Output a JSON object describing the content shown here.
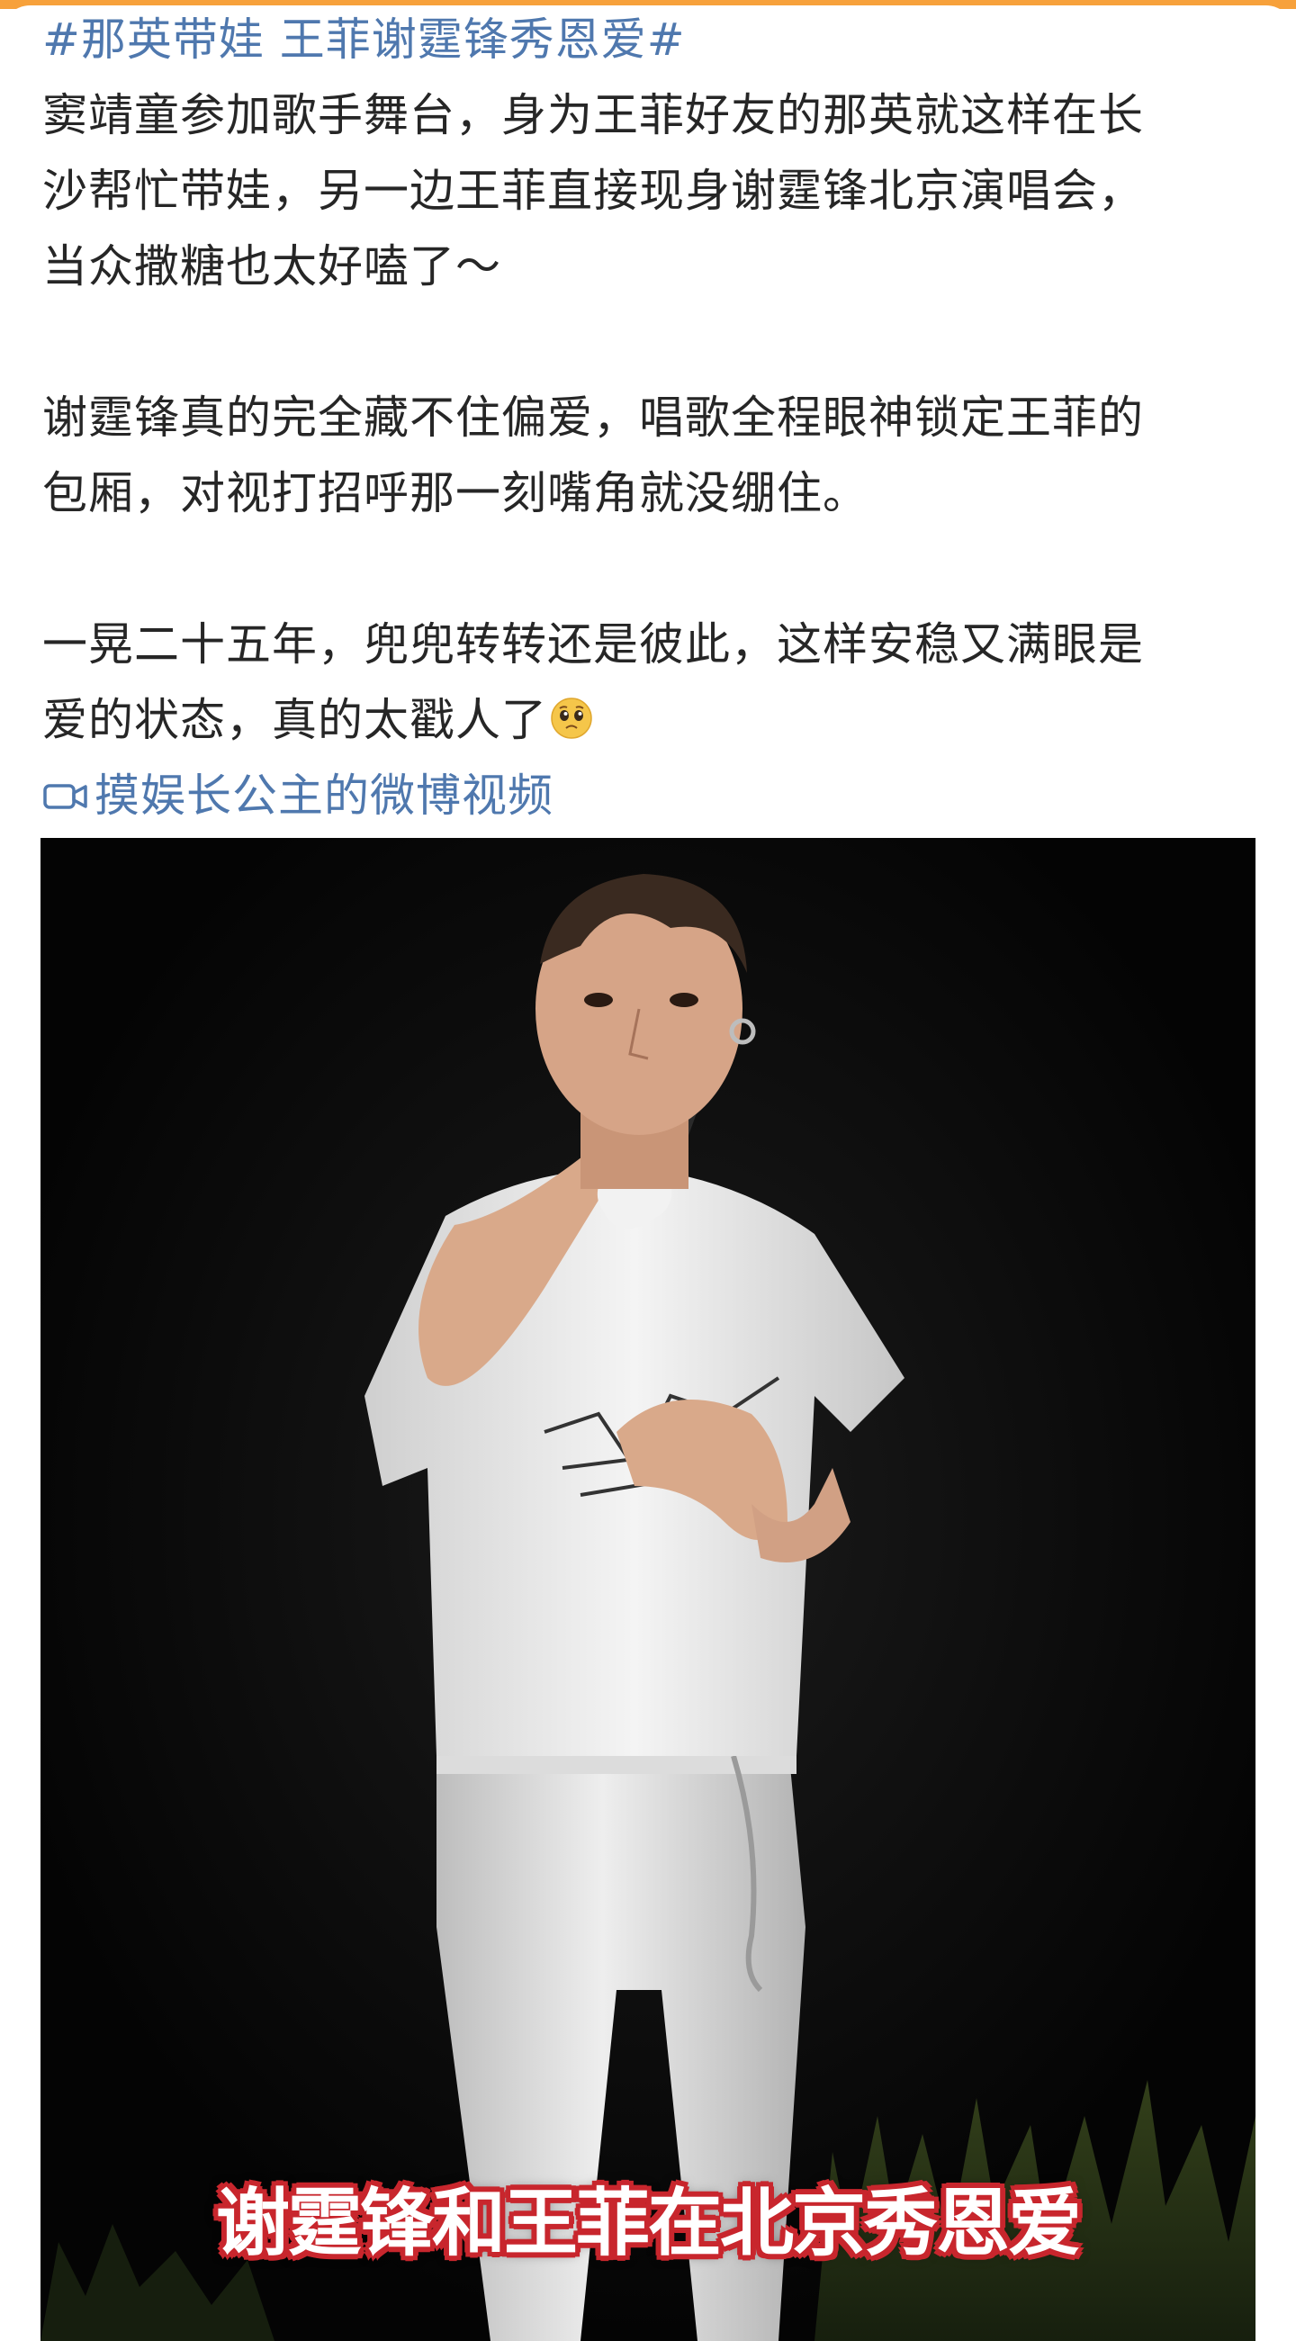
{
  "post": {
    "topic": "#那英带娃 王菲谢霆锋秀恩爱#",
    "paragraphs": [
      {
        "lines": [
          "窦靖童参加歌手舞台，身为王菲好友的那英就这样在长",
          "沙帮忙带娃，另一边王菲直接现身谢霆锋北京演唱会，",
          "当众撒糖也太好嗑了～"
        ]
      },
      {
        "lines": [
          "谢霆锋真的完全藏不住偏爱，唱歌全程眼神锁定王菲的",
          "包厢，对视打招呼那一刻嘴角就没绷住。"
        ]
      },
      {
        "lines": [
          "一晃二十五年，兜兜转转还是彼此，这样安稳又满眼是",
          "爱的状态，真的太戳人了"
        ],
        "trailing_emoji": "pleading-face-emoji"
      }
    ],
    "video_link": {
      "icon": "video-camera-icon",
      "label": "摸娱长公主的微博视频"
    }
  },
  "video": {
    "caption": "谢霆锋和王菲在北京秀恩爱",
    "caption_color": "#ffffff",
    "caption_outline": "#c8262d"
  },
  "colors": {
    "link": "#4f78ae",
    "text": "#262626",
    "accent": "#f7a13b"
  }
}
